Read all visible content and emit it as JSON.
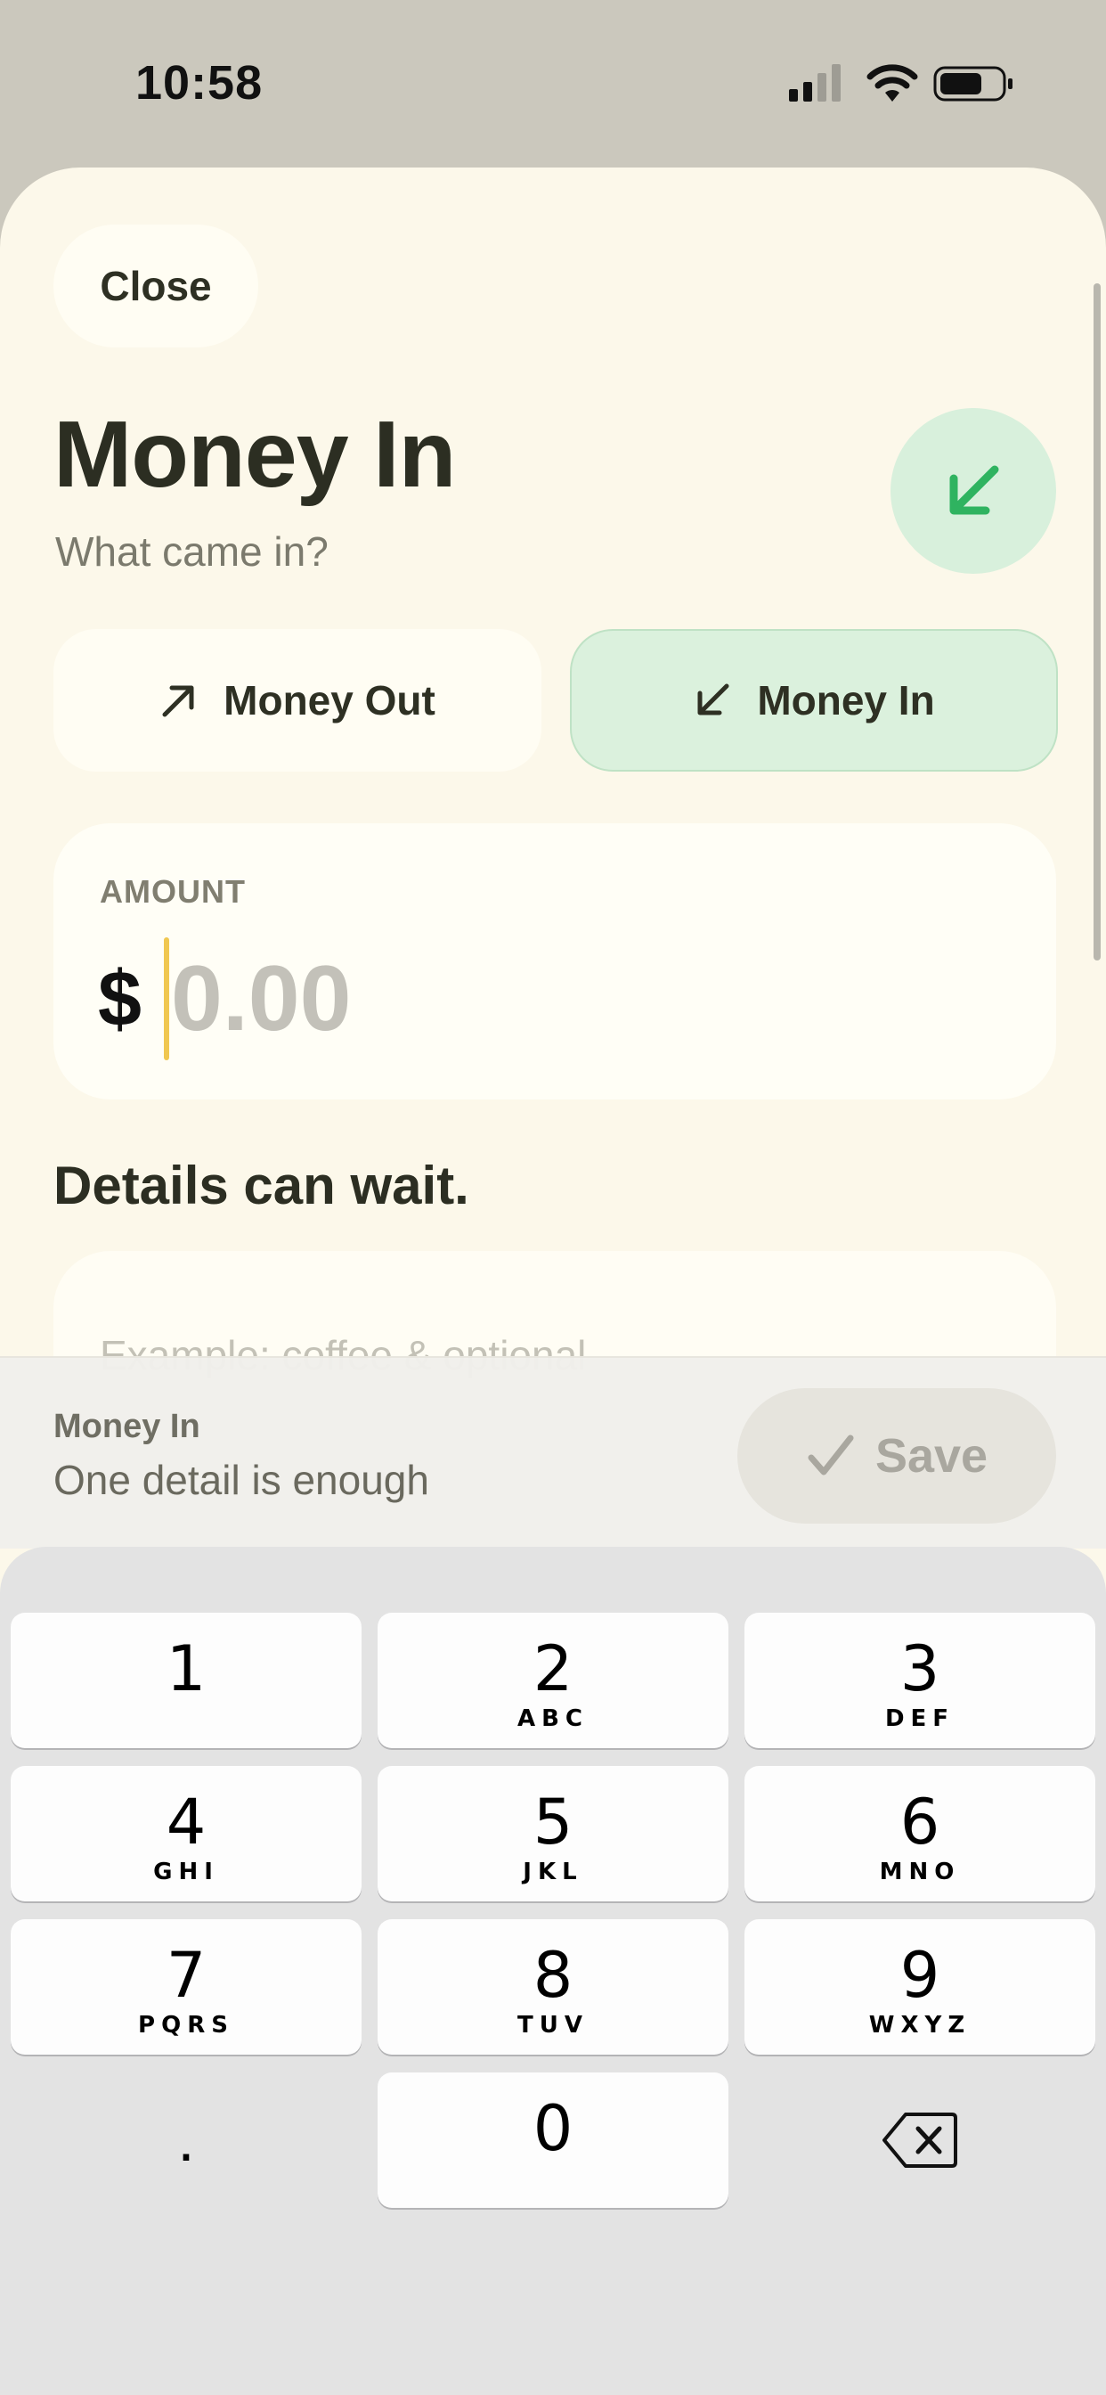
{
  "status_bar": {
    "time": "10:58"
  },
  "header": {
    "close_label": "Close",
    "title": "Money In",
    "subtitle": "What came in?"
  },
  "type_toggle": {
    "out_label": "Money Out",
    "in_label": "Money In",
    "selected": "Money In"
  },
  "amount": {
    "label": "AMOUNT",
    "currency": "$",
    "placeholder": "0.00"
  },
  "details": {
    "heading": "Details can wait.",
    "placeholder": "Example: coffee & optional"
  },
  "save_bar": {
    "title": "Money In",
    "hint": "One detail is enough",
    "save_label": "Save"
  },
  "keypad": {
    "keys": [
      {
        "digit": "1",
        "letters": ""
      },
      {
        "digit": "2",
        "letters": "ABC"
      },
      {
        "digit": "3",
        "letters": "DEF"
      },
      {
        "digit": "4",
        "letters": "GHI"
      },
      {
        "digit": "5",
        "letters": "JKL"
      },
      {
        "digit": "6",
        "letters": "MNO"
      },
      {
        "digit": "7",
        "letters": "PQRS"
      },
      {
        "digit": "8",
        "letters": "TUV"
      },
      {
        "digit": "9",
        "letters": "WXYZ"
      },
      {
        "digit": "0",
        "letters": ""
      }
    ],
    "decimal": ".",
    "delete_icon": "delete-backspace-icon"
  },
  "colors": {
    "sheet_bg": "#fcf8ea",
    "accent_green": "#2fb360",
    "selected_bg": "#dbf1dd",
    "caret": "#f0c750"
  }
}
